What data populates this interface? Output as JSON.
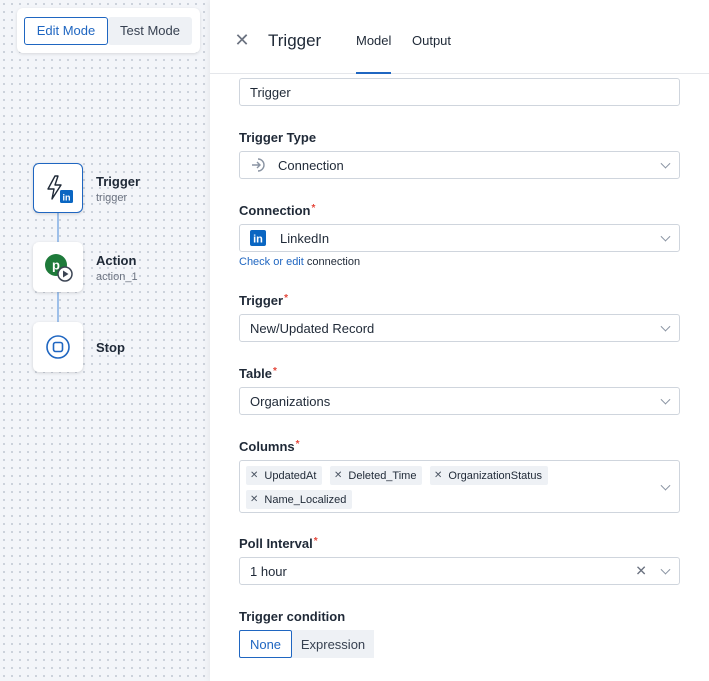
{
  "modes": {
    "edit": "Edit Mode",
    "test": "Test Mode"
  },
  "flow": {
    "nodes": [
      {
        "title": "Trigger",
        "subtitle": "trigger"
      },
      {
        "title": "Action",
        "subtitle": "action_1"
      },
      {
        "title": "Stop",
        "subtitle": ""
      }
    ]
  },
  "panel": {
    "title": "Trigger",
    "tabs": {
      "model": "Model",
      "output": "Output"
    },
    "name_value": "Trigger",
    "trigger_type": {
      "label": "Trigger Type",
      "value": "Connection"
    },
    "connection": {
      "label": "Connection",
      "value": "LinkedIn",
      "link": "Check or edit",
      "link_suffix": " connection"
    },
    "trigger": {
      "label": "Trigger",
      "value": "New/Updated Record"
    },
    "table": {
      "label": "Table",
      "value": "Organizations"
    },
    "columns": {
      "label": "Columns",
      "items": [
        "UpdatedAt",
        "Deleted_Time",
        "OrganizationStatus",
        "Name_Localized"
      ]
    },
    "poll_interval": {
      "label": "Poll Interval",
      "value": "1 hour"
    },
    "trigger_condition": {
      "label": "Trigger condition",
      "options": [
        "None",
        "Expression"
      ]
    },
    "required_mark": "*"
  },
  "colors": {
    "accent": "#1f66c1",
    "linkedin": "#0a66c2",
    "action_green": "#1e7a3a",
    "required": "#e5483c"
  }
}
